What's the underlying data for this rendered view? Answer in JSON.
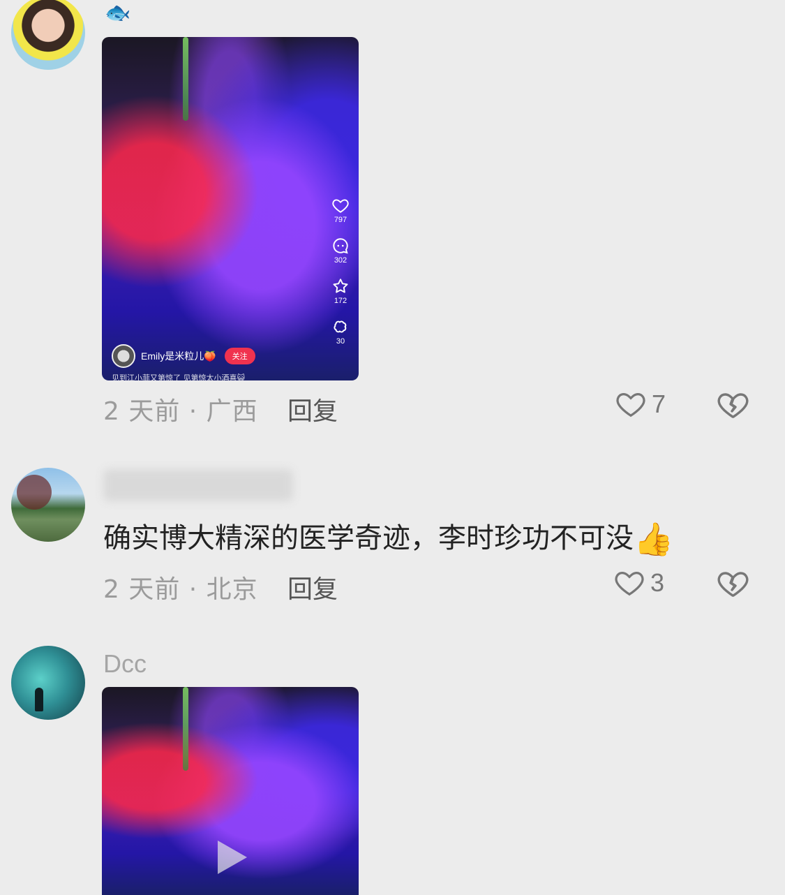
{
  "comments": [
    {
      "username_emoji": "🐟",
      "video": {
        "likes": "797",
        "comments": "302",
        "favorites": "172",
        "shares": "30",
        "author": "Emily是米粒儿🍑",
        "follow_label": "关注",
        "caption": "见到江小菲又第惊了 见第惊太小酒喜😺"
      },
      "meta": "2 天前 · 广西",
      "reply_label": "回复",
      "like_count": "7"
    },
    {
      "text": "确实博大精深的医学奇迹，李时珍功不可没",
      "emoji": "👍",
      "meta": "2 天前 · 北京",
      "reply_label": "回复",
      "like_count": "3"
    },
    {
      "username": "Dcc"
    }
  ],
  "icons": [
    "heart-icon",
    "comment-icon",
    "star-icon",
    "share-icon",
    "like-heart-icon",
    "broken-heart-icon",
    "play-icon"
  ]
}
